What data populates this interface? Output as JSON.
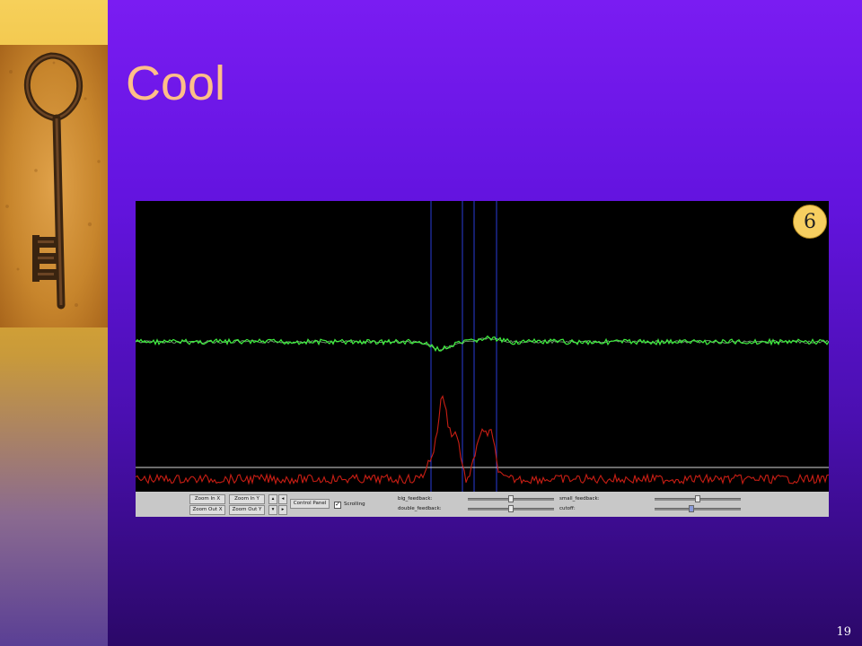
{
  "slide": {
    "title": "Cool",
    "number": "19"
  },
  "screenshot": {
    "badge": "6",
    "controls": {
      "zoom_in_x": "Zoom In X",
      "zoom_out_x": "Zoom Out X",
      "zoom_in_y": "Zoom In Y",
      "zoom_out_y": "Zoom Out Y",
      "arrow_up": "▴",
      "arrow_down": "▾",
      "arrow_left": "◂",
      "arrow_right": "▸",
      "control_panel": "Control Panel",
      "scrolling_checked": "✓",
      "scrolling": "Scrolling",
      "big_feedback": "big_feedback:",
      "double_feedback": "double_feedback:",
      "small_feedback": "small_feedback:",
      "cutoff": "cutoff:",
      "big_feedback_level": 0.5,
      "double_feedback_level": 0.5,
      "small_feedback_level": 0.5,
      "cutoff_level": 0.43
    }
  },
  "colors": {
    "background_top": "#7a1cf2",
    "background_bottom": "#2b0868",
    "title": "#ffbf88",
    "signal_green": "#3ef03e",
    "signal_red": "#c81e14",
    "marker_blue": "#2a3cd8"
  },
  "icons": [
    "skeleton-key-photo"
  ]
}
